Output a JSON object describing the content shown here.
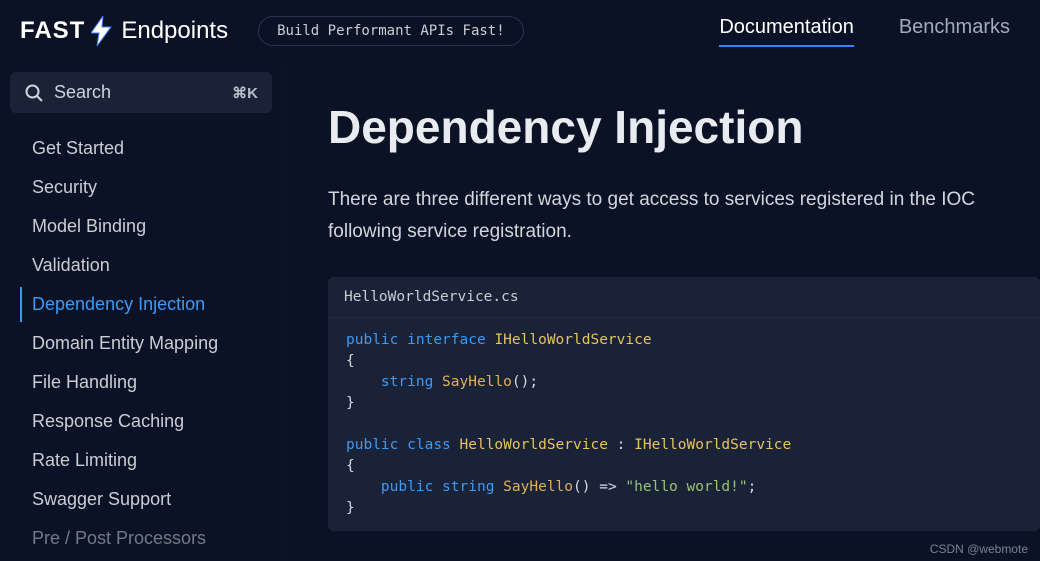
{
  "header": {
    "logo_fast": "FAST",
    "logo_endpoints": "Endpoints",
    "tagline": "Build Performant APIs Fast!"
  },
  "nav": {
    "documentation": "Documentation",
    "benchmarks": "Benchmarks"
  },
  "search": {
    "placeholder": "Search",
    "shortcut": "⌘K"
  },
  "sidebar": {
    "items": [
      "Get Started",
      "Security",
      "Model Binding",
      "Validation",
      "Dependency Injection",
      "Domain Entity Mapping",
      "File Handling",
      "Response Caching",
      "Rate Limiting",
      "Swagger Support",
      "Pre / Post Processors"
    ],
    "active_index": 4
  },
  "content": {
    "title": "Dependency Injection",
    "description": "There are three different ways to get access to services registered in the IOC following service registration."
  },
  "code": {
    "filename": "HelloWorldService.cs",
    "tokens": {
      "public": "public",
      "interface": "interface",
      "class": "class",
      "string_kw": "string",
      "iface_name": "IHelloWorldService",
      "cls_name": "HelloWorldService",
      "method": "SayHello",
      "str_lit": "\"hello world!\"",
      "brace_open": "{",
      "brace_close": "}",
      "paren": "()",
      "semi": ";",
      "colon": " : ",
      "arrow": " => "
    }
  },
  "watermark": "CSDN @webmote"
}
